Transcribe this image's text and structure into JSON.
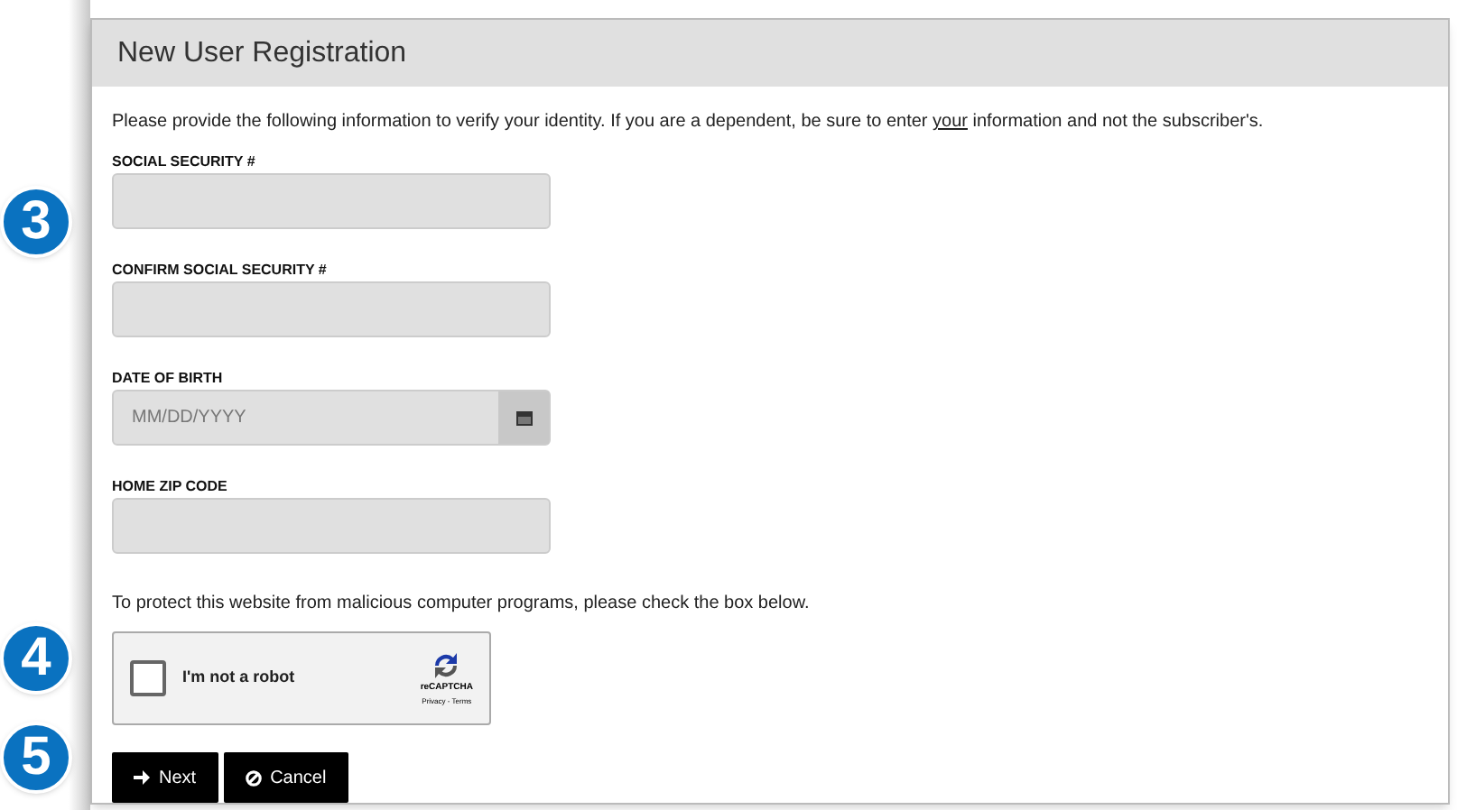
{
  "header": {
    "title": "New User Registration"
  },
  "intro": "Please provide the following information to verify your identity. If you are a dependent, be sure to enter ",
  "intro_link": "your",
  "intro_end": " information and not the subscriber's.",
  "fields": [
    {
      "label": "SOCIAL SECURITY #",
      "kind": "text"
    },
    {
      "label": "CONFIRM SOCIAL SECURITY #",
      "kind": "text"
    },
    {
      "label": "DATE OF BIRTH",
      "kind": "date",
      "placeholder": "MM/DD/YYYY"
    },
    {
      "label": "HOME ZIP CODE",
      "kind": "text"
    }
  ],
  "captcha_note": "To protect this website from malicious computer programs, please check the box below.",
  "captcha": {
    "label": "I'm not a robot",
    "checked": false,
    "brand": "reCAPTCHA",
    "links": "Privacy - Terms"
  },
  "buttons": [
    {
      "label": "Next",
      "kind": "next"
    },
    {
      "label": "Cancel",
      "kind": "cancel"
    }
  ],
  "steps": [
    {
      "number": "3"
    },
    {
      "number": "4"
    },
    {
      "number": "5"
    }
  ]
}
